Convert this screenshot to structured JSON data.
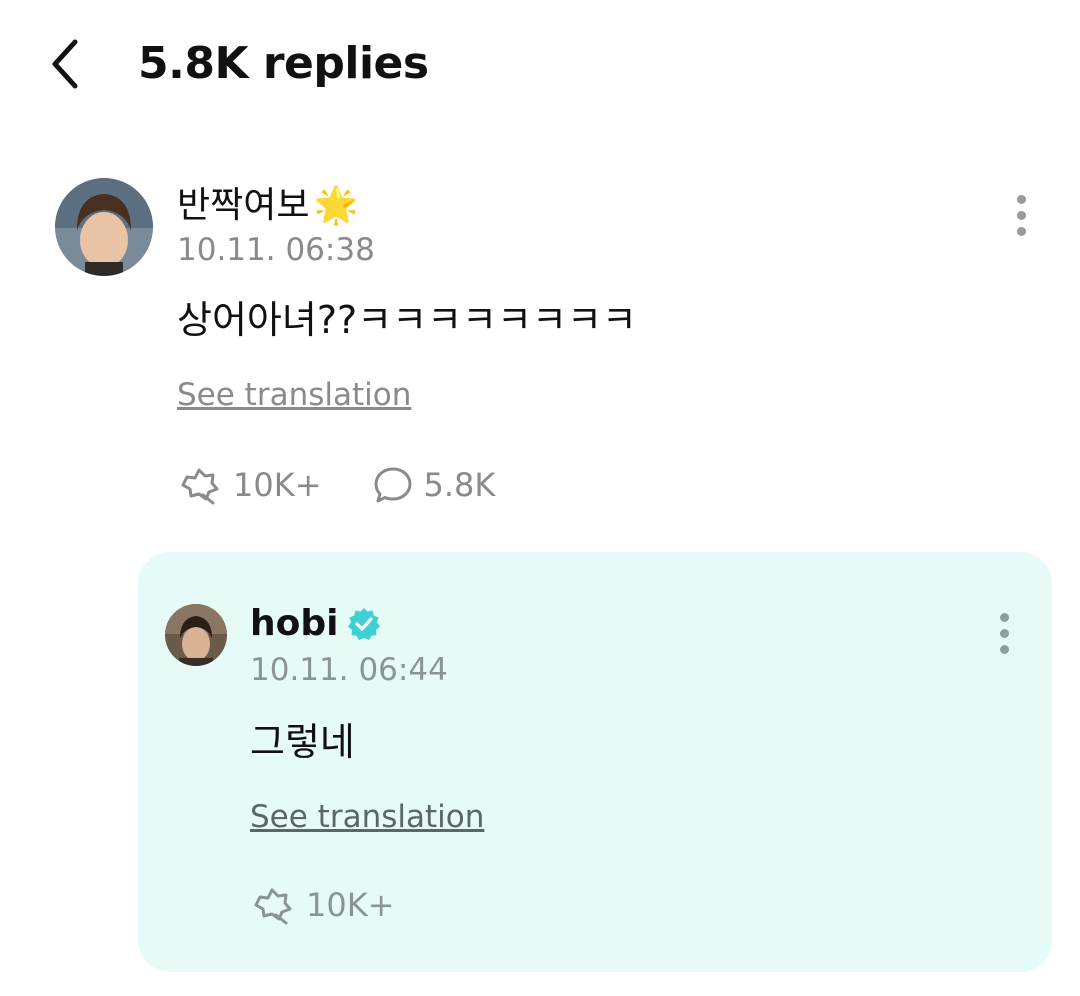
{
  "header": {
    "title": "5.8K replies",
    "back_icon": "chevron-left-icon"
  },
  "comment": {
    "username": "반짝여보",
    "username_badge": "🌟",
    "timestamp": "10.11. 06:38",
    "text": "상어아녀??ㅋㅋㅋㅋㅋㅋㅋㅋ",
    "see_translation": "See translation",
    "reactions_count": "10K+",
    "replies_count": "5.8K",
    "reaction_icon": "reaction-icon",
    "reply_icon": "speech-bubble-icon",
    "more_icon": "more-vertical-icon"
  },
  "reply": {
    "username": "hobi",
    "verified_icon": "verified-badge-icon",
    "timestamp": "10.11. 06:44",
    "text": "그렇네",
    "see_translation": "See translation",
    "reactions_count": "10K+",
    "card_color": "#e6fbf7",
    "verified_color": "#3fd0d4"
  }
}
